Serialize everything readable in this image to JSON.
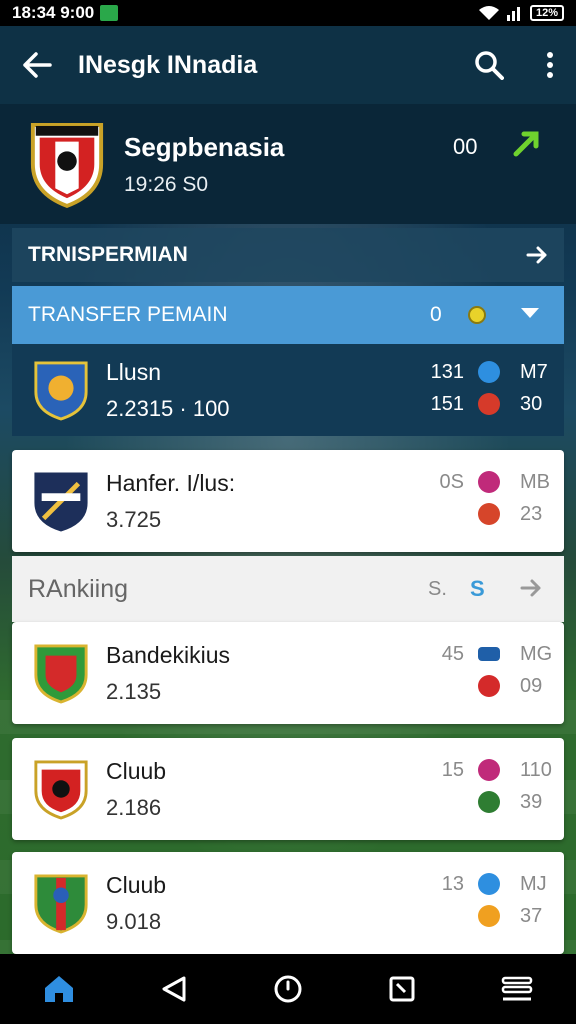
{
  "status_bar": {
    "time": "18:34 9:00",
    "battery": "12%"
  },
  "app_bar": {
    "title": "INesgk INnadia"
  },
  "team_header": {
    "name": "Segpbenasia",
    "date": "19:26 S0",
    "score": "00"
  },
  "section": {
    "label": "TRNISPERMIAN"
  },
  "transfer": {
    "header_label": "TRANSFER PEMAIN",
    "count": "0",
    "row": {
      "name": "Llusn",
      "value": "2.2315 · 100",
      "stats": [
        [
          "131",
          "M7"
        ],
        [
          "151",
          "30"
        ]
      ]
    }
  },
  "cards_top": [
    {
      "name": "Hanfer. I/lus:",
      "value": "3.725",
      "stats": [
        [
          "0S",
          "MB"
        ],
        [
          "",
          "23"
        ]
      ]
    }
  ],
  "ranking": {
    "label": "RAnkiing",
    "s1": "S.",
    "s2": "S"
  },
  "cards_bottom": [
    {
      "name": "Bandekikius",
      "value": "2.135",
      "stats": [
        [
          "45",
          "MG"
        ],
        [
          "",
          "09"
        ]
      ]
    },
    {
      "name": "Cluub",
      "value": "2.186",
      "stats": [
        [
          "15",
          "110"
        ],
        [
          "",
          "39"
        ]
      ]
    },
    {
      "name": "Cluub",
      "value": "9.018",
      "stats": [
        [
          "13",
          "MJ"
        ],
        [
          "",
          "37"
        ]
      ]
    }
  ],
  "colors": {
    "accent_blue": "#4a9ad6",
    "header_dark": "#0a2638",
    "green_arrow": "#6fd22e"
  }
}
